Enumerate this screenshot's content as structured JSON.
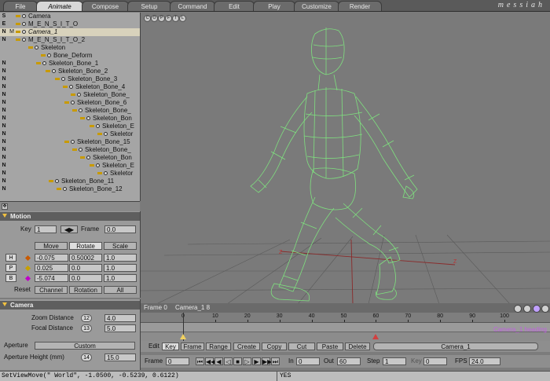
{
  "tabs": [
    {
      "label": "File",
      "active": false
    },
    {
      "label": "Animate",
      "active": true
    },
    {
      "label": "Compose",
      "active": false
    },
    {
      "label": "Setup",
      "active": false
    },
    {
      "label": "Command",
      "active": false
    },
    {
      "label": "Edit",
      "active": false
    },
    {
      "label": "Play",
      "active": false
    },
    {
      "label": "Customize",
      "active": false
    },
    {
      "label": "Render",
      "active": false
    }
  ],
  "brand": "messiah",
  "tree": {
    "rows": [
      {
        "flag": "S",
        "label": "Camera",
        "italic": false,
        "selected": false
      },
      {
        "flag": "E",
        "label": "M_E_N_S_I_T_O",
        "italic": false,
        "selected": false
      },
      {
        "flag": "N",
        "flag2": "M",
        "label": "Camera_1",
        "italic": true,
        "selected": true
      },
      {
        "flag": "N",
        "label": "M_E_N_S_I_T_O_2",
        "italic": false,
        "selected": false
      },
      {
        "flag": "",
        "label": "Skeleton",
        "italic": false,
        "selected": false
      },
      {
        "flag": "",
        "label": "Bone_Deform",
        "italic": false,
        "selected": false
      },
      {
        "flag": "N",
        "label": "Skeleton_Bone_1",
        "italic": false,
        "selected": false
      },
      {
        "flag": "N",
        "label": "Skeleton_Bone_2",
        "italic": false,
        "selected": false
      },
      {
        "flag": "N",
        "label": "Skeleton_Bone_3",
        "italic": false,
        "selected": false
      },
      {
        "flag": "N",
        "label": "Skeleton_Bone_4",
        "italic": false,
        "selected": false
      },
      {
        "flag": "N",
        "label": "Skeleton_Bone_",
        "italic": false,
        "selected": false
      },
      {
        "flag": "N",
        "label": "Skeleton_Bone_6",
        "italic": false,
        "selected": false
      },
      {
        "flag": "N",
        "label": "Skeleton_Bone_",
        "italic": false,
        "selected": false
      },
      {
        "flag": "N",
        "label": "Skeleton_Bon",
        "italic": false,
        "selected": false
      },
      {
        "flag": "N",
        "label": "Skeleton_E",
        "italic": false,
        "selected": false
      },
      {
        "flag": "N",
        "label": "Skeletor",
        "italic": false,
        "selected": false
      },
      {
        "flag": "N",
        "label": "Skeleton_Bone_15",
        "italic": false,
        "selected": false
      },
      {
        "flag": "N",
        "label": "Skeleton_Bone_",
        "italic": false,
        "selected": false
      },
      {
        "flag": "N",
        "label": "Skeleton_Bon",
        "italic": false,
        "selected": false
      },
      {
        "flag": "N",
        "label": "Skeleton_E",
        "italic": false,
        "selected": false
      },
      {
        "flag": "N",
        "label": "Skeletor",
        "italic": false,
        "selected": false
      },
      {
        "flag": "N",
        "label": "Skeleton_Bone_11",
        "italic": false,
        "selected": false
      },
      {
        "flag": "N",
        "label": "Skeleton_Bone_12",
        "italic": false,
        "selected": false
      }
    ]
  },
  "motion": {
    "title": "Motion",
    "key_label": "Key",
    "key_value": "1",
    "frame_label": "Frame",
    "frame_value": "0.0",
    "modes": [
      "Move",
      "Rotate",
      "Scale"
    ],
    "active_mode": "Rotate",
    "channels": [
      {
        "name": "H",
        "v1": "-0.075",
        "v2": "0.50002",
        "v3": "1.0",
        "color": "#c85a00"
      },
      {
        "name": "P",
        "v1": "0.025",
        "v2": "0.0",
        "v3": "1.0",
        "color": "#c8a000"
      },
      {
        "name": "B",
        "v1": "-5.074",
        "v2": "0.0",
        "v3": "1.0",
        "color": "#c000c8"
      }
    ],
    "reset_label": "Reset",
    "reset_buttons": [
      "Channel",
      "Rotation",
      "All"
    ]
  },
  "camera": {
    "title": "Camera",
    "zoom_label": "Zoom Distance",
    "zoom_num": "12",
    "zoom_value": "4.0",
    "focal_label": "Focal Distance",
    "focal_num": "13",
    "focal_value": "5.0",
    "aperture_label": "Aperture",
    "aperture_value": "Custom",
    "height_label": "Aperture Height (mm)",
    "height_num": "14",
    "height_value": "15.0"
  },
  "viewport": {
    "top_buttons": [
      "C",
      "O",
      "P",
      "F",
      "T",
      "L"
    ],
    "frame_text": "Frame 0",
    "camera_text": "Camera_1 8",
    "axis_label": "Z",
    "accent_wire": "#7fe07f"
  },
  "timeline": {
    "ticks": [
      "0",
      "10",
      "20",
      "30",
      "40",
      "50",
      "60",
      "70",
      "80",
      "90",
      "100"
    ],
    "track_label": "Camera_1 heading",
    "key_frame": 60,
    "current_frame": 0
  },
  "toolbar": {
    "edit_label": "Edit",
    "edit_buttons": [
      "Key",
      "Frame",
      "Range"
    ],
    "active_edit": "Key",
    "action_buttons": [
      "Create",
      "Copy",
      "Cut",
      "Paste",
      "Delete"
    ],
    "item_select": "Camera_1"
  },
  "transport": {
    "frame_label": "Frame",
    "frame_value": "0",
    "in_label": "In",
    "in_value": "0",
    "out_label": "Out",
    "out_value": "60",
    "step_label": "Step",
    "step_value": "1",
    "key_label": "Key",
    "key_value": "0",
    "fps_label": "FPS",
    "fps_value": "24.0"
  },
  "statusbar": {
    "command": "SetViewMove(\" World\", -1.0500, -0.5239, 0.6122)",
    "message": "YES"
  }
}
